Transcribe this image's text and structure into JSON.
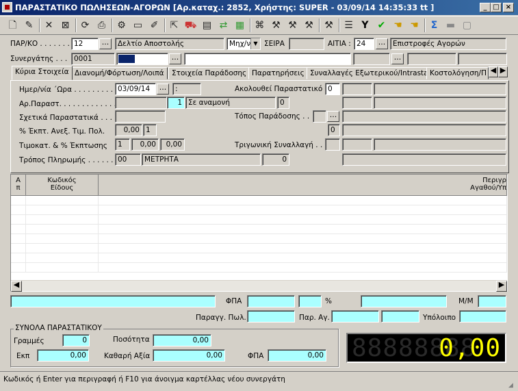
{
  "window": {
    "title": "ΠΑΡΑΣΤΑΤΙΚΟ ΠΩΛΗΣΕΩΝ-ΑΓΟΡΩΝ [Αρ.καταχ.: 2852, Χρήστης: SUPER - 03/09/14 14:35:33 tt ]",
    "min": "_",
    "max": "□",
    "close": "×"
  },
  "toolbar": {
    "icons": [
      "new-doc-icon",
      "open-icon",
      "delete-icon",
      "clear-icon",
      "refresh-icon",
      "print-icon",
      "settings-icon",
      "folder-icon",
      "edit-icon",
      "export-icon",
      "truck-icon",
      "archive-icon",
      "transfer-icon",
      "report-icon",
      "link-icon",
      "hammer-icon",
      "hammer2-icon",
      "hammer3-icon",
      "hammer4-icon",
      "notes-icon",
      "filter-icon",
      "check-icon",
      "hand-icon",
      "hand2-icon",
      "sigma-icon",
      "disk-icon",
      "disk2-icon"
    ]
  },
  "header": {
    "par_ko_label": "ΠΑΡ/ΚΟ . . . . . . .",
    "par_ko_value": "12",
    "par_ko_name": "Δελτίο Αποστολής",
    "mode_value": "Μηχ/ν",
    "seira_label": "ΣΕΙΡΑ",
    "aitia_label": "ΑΙΤΙΑ :",
    "aitia_value": "24",
    "aitia_name": "Επιστροφές Αγορών",
    "synergatis_label": "Συνεργάτης . . .",
    "synergatis_value": "0001",
    "btn_dots": "..."
  },
  "tabs": [
    "Κύρια Στοιχεία",
    "Διανομή/Φόρτωση/Λοιπά",
    "Στοιχεία Παράδοσης",
    "Παρατηρήσεις",
    "Συναλλαγές Εξωτερικού/Intrastat",
    "Κοστολόγηση/Π"
  ],
  "main": {
    "date_label": "Ημερ/νία ΄Ωρα . . . . . . . . . .",
    "date_value": "03/09/14",
    "time_value": ":",
    "follows_label": "Ακολουθεί Παραστατικό .",
    "follows_value": "0",
    "ar_label": "Αρ.Παραστ. . . . . . . . . . . . .",
    "ar_value": "1",
    "ar_status": "Σε αναμονή",
    "ar_right": "0",
    "related_label": "Σχετικά Παραστατικά . . .",
    "topos_label": "Τόπος Παράδοσης . .",
    "discount_label": "% Έκπτ. Ανεξ. Τιμ. Πολ.",
    "discount_value": "0,00",
    "discount_b": "1",
    "topos_right": "0",
    "timokat_label": "Τιμοκατ. & % Έκπτωσης",
    "timokat_value": "1",
    "timokat_a": "0,00",
    "timokat_b": "0,00",
    "trig_label": "Τριγωνική Συναλλαγή . . .",
    "payment_label": "Τρόπος Πληρωμής . . . . . . .",
    "payment_code": "00",
    "payment_name": "ΜΕΤΡΗΤΑ",
    "payment_right": "0"
  },
  "grid": {
    "col_a": "Α\nπ",
    "col_code": "Κωδικός\nΕίδους",
    "col_desc": "Περιγρ\nΑγαθού/Υπ"
  },
  "bottom": {
    "fpa_label": "ΦΠΑ",
    "pct": "%",
    "mm_label": "Μ/Μ",
    "parag_label": "Παραγγ. Πωλ.",
    "parag_ag_label": "Παρ. Αγ.",
    "ypoloipo_label": "Υπόλοιπο"
  },
  "totals": {
    "title": "ΣΥΝΟΛΑ ΠΑΡΑΣΤΑΤΙΚΟΥ",
    "grammes_label": "Γραμμές",
    "grammes_value": "0",
    "posotita_label": "Ποσότητα",
    "posotita_value": "0,00",
    "ekp_label": "Εκπ",
    "ekp_value": "0,00",
    "kathari_label": "Καθαρή Αξία",
    "kathari_value": "0,00",
    "fpa_label": "ΦΠΑ",
    "fpa_value": "0,00",
    "led_value": "0,00",
    "led_dim": "88888888"
  },
  "status": "Κωδικός ή Enter για περιγραφή ή F10 για άνοιγμα καρτέλλας νέου συνεργάτη"
}
